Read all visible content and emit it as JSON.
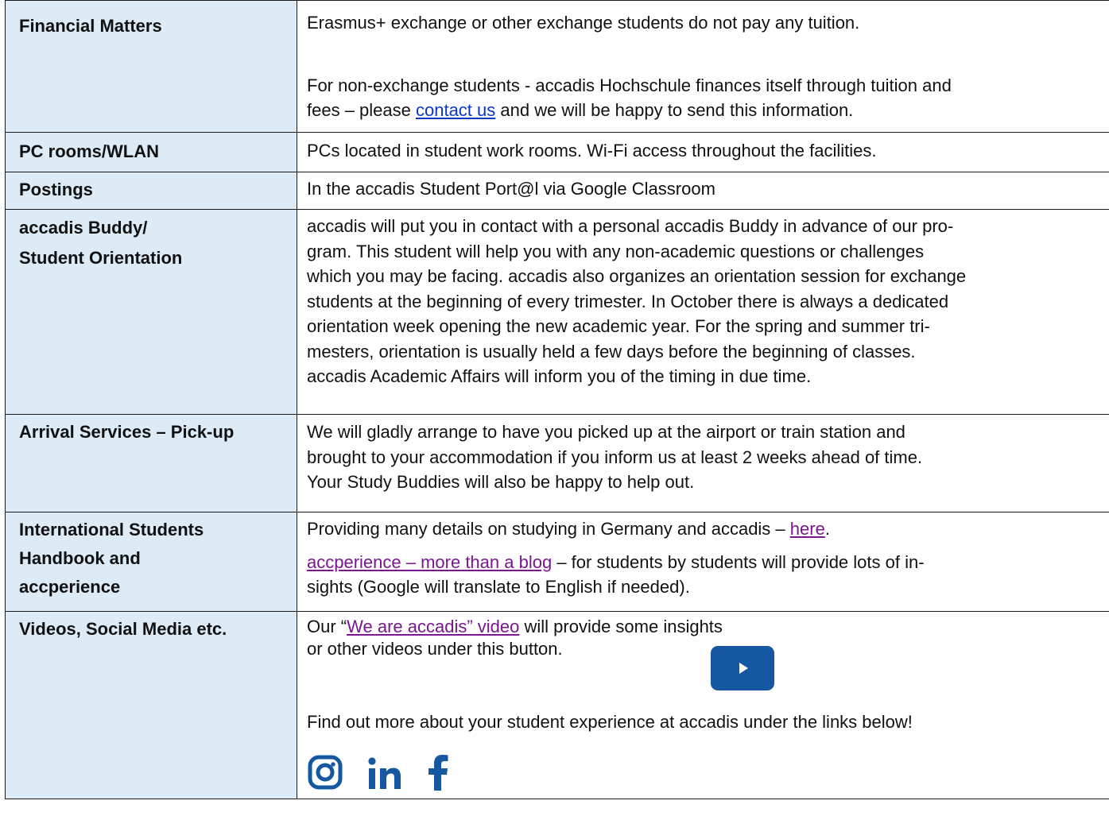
{
  "colors": {
    "label_bg": "#dcebf5",
    "link_blue": "#0a36c9",
    "link_visited": "#7a1790",
    "brand_blue": "#1557a0"
  },
  "rows": {
    "financial": {
      "label": "Financial Matters",
      "p1": "Erasmus+ exchange or other exchange students do not pay any tuition.",
      "p2_line1": "For non-exchange students - accadis Hochschule finances itself through tuition and",
      "p2_before": "fees – please ",
      "p2_link": "contact us",
      "p2_after": " and we will be happy to send this information."
    },
    "pc": {
      "label": "PC rooms/WLAN",
      "text": "PCs located in student work rooms. Wi-Fi access throughout the facilities."
    },
    "postings": {
      "label": "Postings",
      "text": "In the accadis Student Port@l via Google Classroom"
    },
    "buddy": {
      "label_line1": "accadis Buddy/",
      "label_line2": "Student Orientation",
      "lines": [
        "accadis will put you in contact with a personal accadis Buddy in advance of our pro-",
        "gram. This student will help you with any non-academic questions or challenges",
        "which you may be facing. accadis also organizes an orientation session for exchange",
        "students at the beginning of every trimester. In October there is always a dedicated",
        "orientation week opening the new academic year. For the spring and summer tri-",
        "mesters, orientation is usually held a few days before the beginning of classes.",
        "accadis Academic Affairs will inform you of the timing in due time."
      ]
    },
    "arrival": {
      "label": "Arrival Services – Pick-up",
      "lines": [
        "We will gladly arrange to have you picked up at the airport or train station and",
        "brought to your accommodation if you inform us at least 2 weeks ahead of time.",
        "Your Study Buddies will also be happy to help out."
      ]
    },
    "handbook": {
      "label_line1": "International Students",
      "label_line2": "Handbook and",
      "label_line3": "accperience",
      "p1_before": "Providing many details on studying in Germany and accadis – ",
      "p1_link": "here",
      "p1_after": ".",
      "p2_link": "accperience – more than a blog",
      "p2_after": " – for students by students will provide lots of in-",
      "p2_line2": "sights (Google will translate to English if needed)."
    },
    "videos": {
      "label": "Videos, Social Media etc.",
      "p1_before": "Our “",
      "p1_link": "We are accadis” video",
      "p1_after": " will provide some insights",
      "p1_line2": "or other videos under this button.",
      "play_icon": "youtube-play-icon",
      "p2": "Find out more about your student experience at accadis under the links below!",
      "social_icons": [
        "instagram-icon",
        "linkedin-icon",
        "facebook-icon"
      ]
    }
  }
}
